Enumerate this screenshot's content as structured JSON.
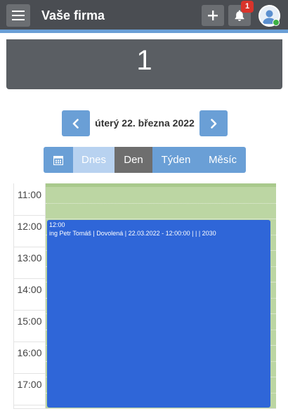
{
  "header": {
    "app_title": "Vaše firma",
    "add_icon": "plus-icon",
    "notification_icon": "bell-icon",
    "notification_count": "1",
    "avatar_icon": "user-avatar-icon",
    "status": "online"
  },
  "counter": {
    "value": "1"
  },
  "date_nav": {
    "prev_icon": "chevron-left-icon",
    "date_label": "úterý 22. března 2022",
    "next_icon": "chevron-right-icon"
  },
  "views": {
    "calendar_icon": "calendar-icon",
    "today": "Dnes",
    "day": "Den",
    "week": "Týden",
    "month": "Měsíc",
    "active": "Den"
  },
  "calendar": {
    "slots": [
      "11:00",
      "12:00",
      "13:00",
      "14:00",
      "15:00",
      "16:00",
      "17:00"
    ],
    "events": [
      {
        "time": "12:00",
        "title": "ing Petr Tomáš | Dovolená | 22.03.2022 - 12:00:00 | | | 2030",
        "color": "#2f66d8"
      }
    ]
  },
  "colors": {
    "topbar": "#4a4d52",
    "accent": "#6a9fd6",
    "day_background": "#bcd6a3",
    "event": "#2f66d8",
    "badge": "#d9342b"
  }
}
